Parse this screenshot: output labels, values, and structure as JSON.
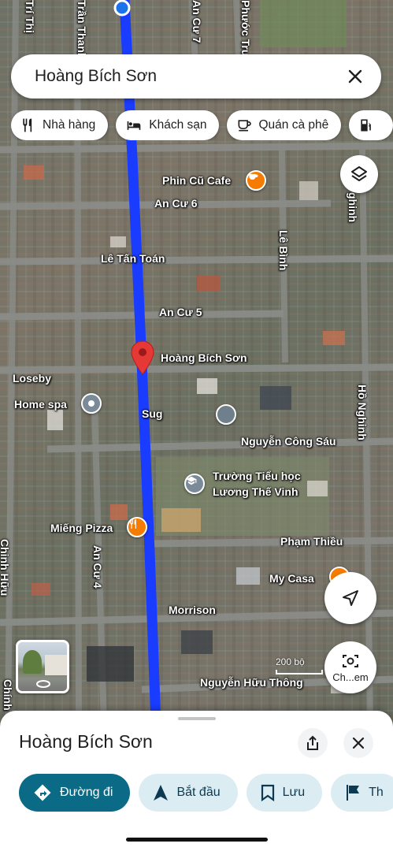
{
  "search": {
    "query": "Hoàng Bích Sơn"
  },
  "chips": [
    {
      "label": "Nhà hàng",
      "icon": "restaurant-icon"
    },
    {
      "label": "Khách sạn",
      "icon": "hotel-icon"
    },
    {
      "label": "Quán cà phê",
      "icon": "coffee-icon"
    },
    {
      "label": "",
      "icon": "gas-station-icon"
    }
  ],
  "map": {
    "streets": {
      "an_cu_6": "An Cư 6",
      "le_tan_toan": "Lê Tấn Toán",
      "an_cu_5": "An Cư 5",
      "loseby": "Loseby",
      "nguyen_cong_sau": "Nguyễn Công Sáu",
      "pham_thieu": "Phạm Thiều",
      "morrison": "Morrison",
      "nguyen_huu_thong": "Nguyễn Hữu Thông",
      "le_binh": "Lê Bình",
      "ho_nghinh": "Hồ Nghinh",
      "ho_nghinh_top": "ghinh",
      "an_cu_4": "An Cư 4",
      "an_cu_7": "An Cư 7",
      "tran_thanh": "Trần Thanh",
      "tri_thi": "Trí Thị",
      "phuoc_tr": "Phước Trư",
      "chinh_huu": "Chinh Hữu",
      "chinh_bottom": "Chính"
    },
    "pois": {
      "phin_cu": "Phin Cũ Cafe",
      "home_spa": "Home spa",
      "sug": "Sug",
      "school_line1": "Trường Tiểu học",
      "school_line2": "Lương Thế Vinh",
      "mieng_pizza": "Miếng Pizza",
      "my_casa": "My Casa"
    },
    "pin_label": "Hoàng Bích Sơn",
    "scale_label": "200 bộ",
    "lens_label": "Ch...em"
  },
  "sheet": {
    "title": "Hoàng Bích Sơn",
    "actions": [
      {
        "label": "Đường đi",
        "icon": "directions-icon"
      },
      {
        "label": "Bắt đầu",
        "icon": "navigation-arrow-icon"
      },
      {
        "label": "Lưu",
        "icon": "bookmark-icon"
      },
      {
        "label": "Th",
        "icon": "flag-icon"
      }
    ]
  },
  "colors": {
    "route": "#1a3cff",
    "pin": "#e53935",
    "primary": "#0b6a86",
    "poi_food": "#f57c00",
    "poi_other": "#7a8a99"
  }
}
